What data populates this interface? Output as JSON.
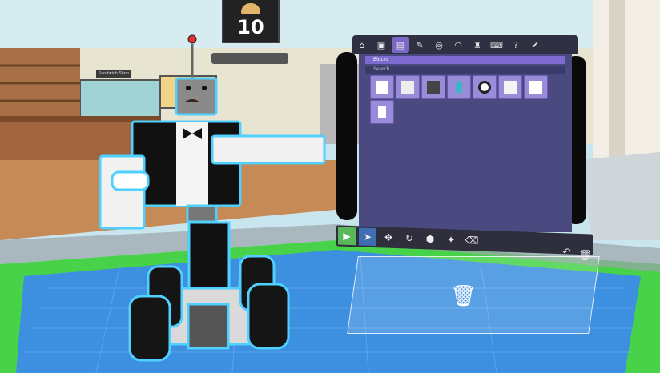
{
  "hud": {
    "counter_value": "10",
    "counter_icon": "sandwich-icon"
  },
  "scene": {
    "sign_text": "Sandwich Shop"
  },
  "tablet": {
    "tabs": [
      {
        "icon": "home-icon",
        "glyph": "⌂",
        "active": false
      },
      {
        "icon": "image-icon",
        "glyph": "▣",
        "active": false
      },
      {
        "icon": "parts-icon",
        "glyph": "▤",
        "active": true
      },
      {
        "icon": "paint-icon",
        "glyph": "✎",
        "active": false
      },
      {
        "icon": "target-icon",
        "glyph": "◎",
        "active": false
      },
      {
        "icon": "signal-icon",
        "glyph": "◠",
        "active": false
      },
      {
        "icon": "robot-icon",
        "glyph": "♜",
        "active": false
      },
      {
        "icon": "keyboard-icon",
        "glyph": "⌨",
        "active": false
      },
      {
        "icon": "help-icon",
        "glyph": "?",
        "active": false
      },
      {
        "icon": "check-icon",
        "glyph": "✔",
        "active": false
      }
    ],
    "category_label": "Blocks",
    "search_placeholder": "Search...",
    "parts": [
      {
        "name": "cube-white"
      },
      {
        "name": "cube-light"
      },
      {
        "name": "cube-dark"
      },
      {
        "name": "cylinder-teal"
      },
      {
        "name": "wheel-black"
      },
      {
        "name": "corner-block"
      },
      {
        "name": "wedge-block"
      },
      {
        "name": "tall-block"
      }
    ]
  },
  "toolbar": {
    "tools": [
      {
        "icon": "play-icon",
        "glyph": "▶"
      },
      {
        "icon": "select-icon",
        "glyph": "➤"
      },
      {
        "icon": "move-icon",
        "glyph": "✥"
      },
      {
        "icon": "rotate-icon",
        "glyph": "↻"
      },
      {
        "icon": "scale-icon",
        "glyph": "⬢"
      },
      {
        "icon": "snap-icon",
        "glyph": "✦"
      },
      {
        "icon": "eraser-icon",
        "glyph": "⌫"
      }
    ],
    "undo_glyph": "↶",
    "delete_glyph": "🗑"
  },
  "trash": {
    "glyph": "🗑"
  },
  "colors": {
    "grid_blue": "#3d8fe0",
    "panel_purple": "#4a4a80",
    "accent_purple": "#7e6bd0",
    "outline_cyan": "#4fd0ff",
    "floor_green": "#47d24a"
  }
}
